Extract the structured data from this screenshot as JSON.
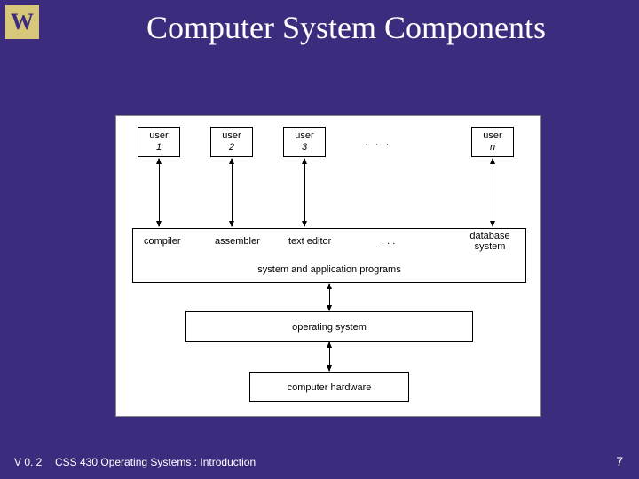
{
  "logo_letter": "W",
  "title": "Computer System Components",
  "diagram": {
    "users": [
      {
        "label": "user",
        "id": "1"
      },
      {
        "label": "user",
        "id": "2"
      },
      {
        "label": "user",
        "id": "3"
      },
      {
        "label": "user",
        "id": "n"
      }
    ],
    "ellipsis": ". . .",
    "programs": [
      "compiler",
      "assembler",
      "text editor",
      ". . .",
      "database system"
    ],
    "sys_label": "system and application programs",
    "os_label": "operating system",
    "hw_label": "computer hardware"
  },
  "footer": {
    "version": "V 0. 2",
    "course": "CSS 430 Operating Systems : Introduction",
    "page": "7"
  }
}
